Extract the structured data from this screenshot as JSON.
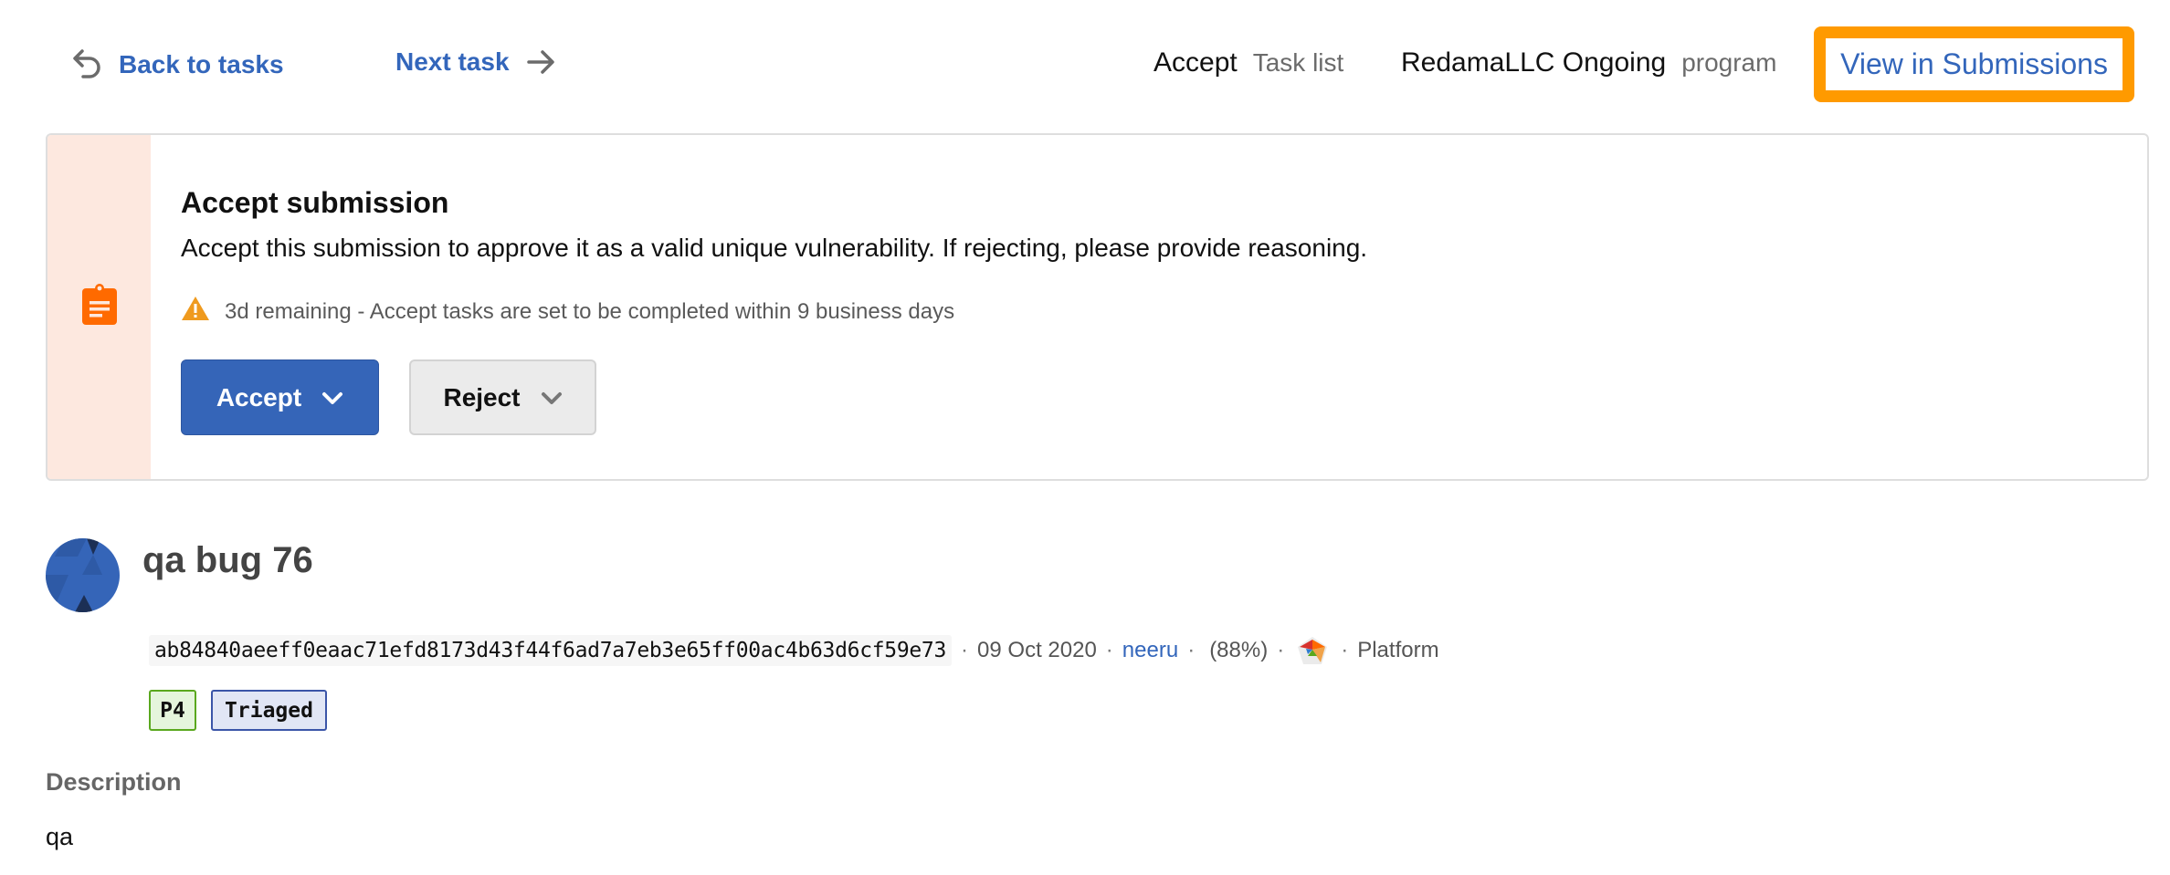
{
  "topbar": {
    "back_label": "Back to tasks",
    "back_icon": "undo-arrow-icon",
    "next_label": "Next task",
    "next_icon": "arrow-right-icon",
    "task_type": "Accept",
    "task_type_suffix": "Task list",
    "program_name": "RedamaLLC Ongoing",
    "program_suffix": "program",
    "view_submissions_label": "View in Submissions",
    "highlight_color": "#ff9a00"
  },
  "banner": {
    "icon": "clipboard-icon",
    "icon_color": "#ff6a00",
    "side_background": "#fde8df",
    "title": "Accept submission",
    "description": "Accept this submission to approve it as a valid unique vulnerability. If rejecting, please provide reasoning.",
    "warning_icon": "warning-triangle-icon",
    "warning_text": "3d remaining - Accept tasks are set to be completed within 9 business days",
    "accept_label": "Accept",
    "reject_label": "Reject",
    "accept_color": "#3565b8"
  },
  "submission": {
    "title": "qa bug 76",
    "hash": "ab84840aeeff0eaac71efd8173d43f44f6ad7a7eb3e65ff00ac4b63d6cf59e73",
    "date": "09 Oct 2020",
    "researcher": "neeru",
    "accuracy": "(88%)",
    "separator": "·",
    "target_icon": "pentagon-skill-chart-icon",
    "target": "Platform",
    "priority_badge": "P4",
    "state_badge": "Triaged"
  },
  "description": {
    "label": "Description",
    "body": "qa"
  }
}
